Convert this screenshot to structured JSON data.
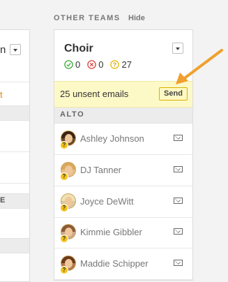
{
  "left_panel": {
    "title_fragment": "n",
    "link_fragment": "t",
    "section_fragment": "E"
  },
  "other_teams": {
    "heading": "OTHER TEAMS",
    "hide_label": "Hide"
  },
  "team": {
    "name": "Choir",
    "stats": {
      "confirmed": "0",
      "declined": "0",
      "unknown": "27"
    },
    "unsent_text": "25 unsent emails",
    "send_label": "Send",
    "voice_section": "ALTO",
    "members": [
      {
        "name": "Ashley Johnson"
      },
      {
        "name": "DJ Tanner"
      },
      {
        "name": "Joyce DeWitt"
      },
      {
        "name": "Kimmie Gibbler"
      },
      {
        "name": "Maddie Schipper"
      }
    ]
  },
  "colors": {
    "accent_orange": "#f0a030",
    "confirmed_green": "#3aa935",
    "declined_red": "#d9403a",
    "unknown_yellow": "#e6b800",
    "unsent_bg": "#fdf9c7"
  }
}
